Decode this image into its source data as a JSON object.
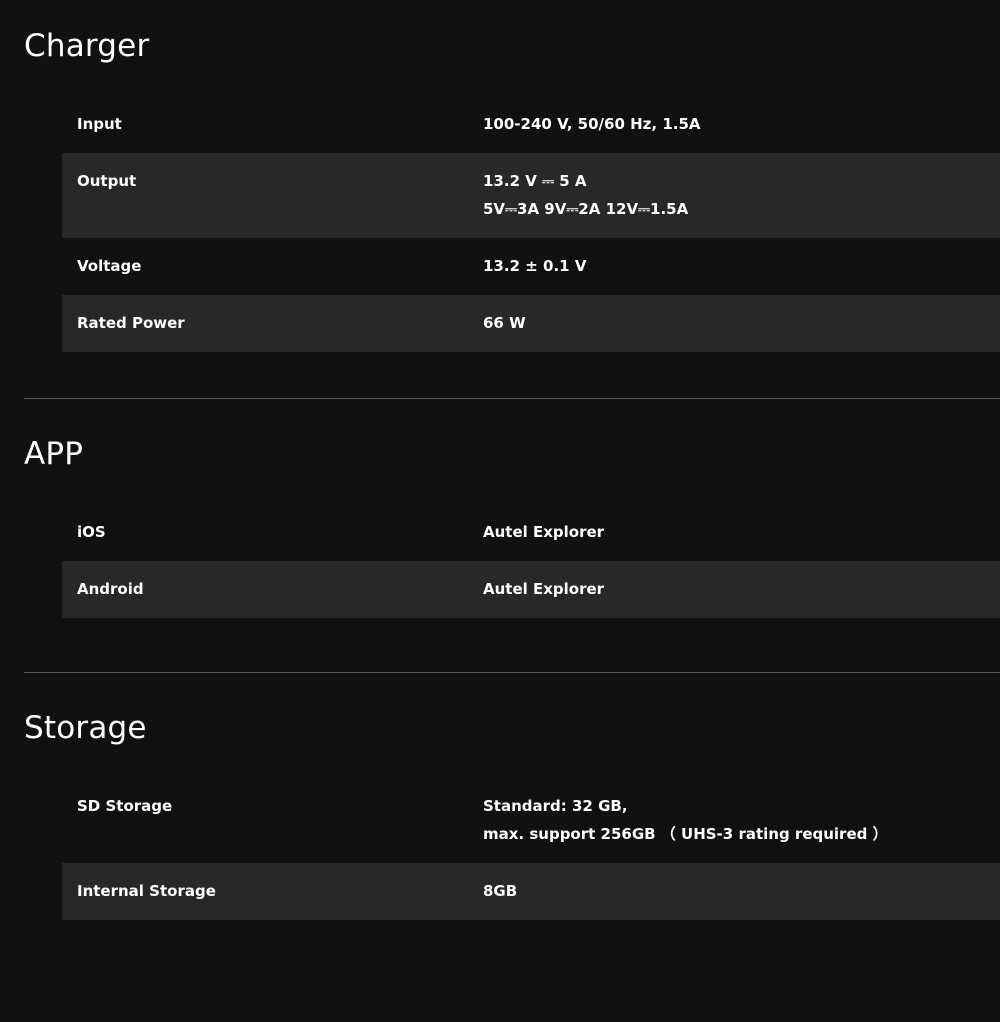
{
  "sections": [
    {
      "title": "Charger",
      "rows": [
        {
          "label": "Input",
          "value": [
            "100-240 V, 50/60 Hz, 1.5A"
          ]
        },
        {
          "label": "Output",
          "value": [
            "13.2 V ⎓ 5 A",
            "5V⎓3A 9V⎓2A 12V⎓1.5A"
          ]
        },
        {
          "label": "Voltage",
          "value": [
            "13.2 ± 0.1 V"
          ]
        },
        {
          "label": "Rated Power",
          "value": [
            "66 W"
          ]
        }
      ]
    },
    {
      "title": "APP",
      "rows": [
        {
          "label": "iOS",
          "value": [
            "Autel Explorer"
          ]
        },
        {
          "label": "Android",
          "value": [
            "Autel Explorer"
          ]
        }
      ]
    },
    {
      "title": "Storage",
      "rows": [
        {
          "label": "SD Storage",
          "value": [
            "Standard: 32 GB,",
            "max. support 256GB （ UHS-3 rating required ）"
          ]
        },
        {
          "label": "Internal Storage",
          "value": [
            "8GB"
          ]
        }
      ]
    }
  ],
  "colors": {
    "background": "#111111",
    "row_alt": "#282828",
    "divider": "#5a5a5a",
    "text": "#ffffff"
  }
}
